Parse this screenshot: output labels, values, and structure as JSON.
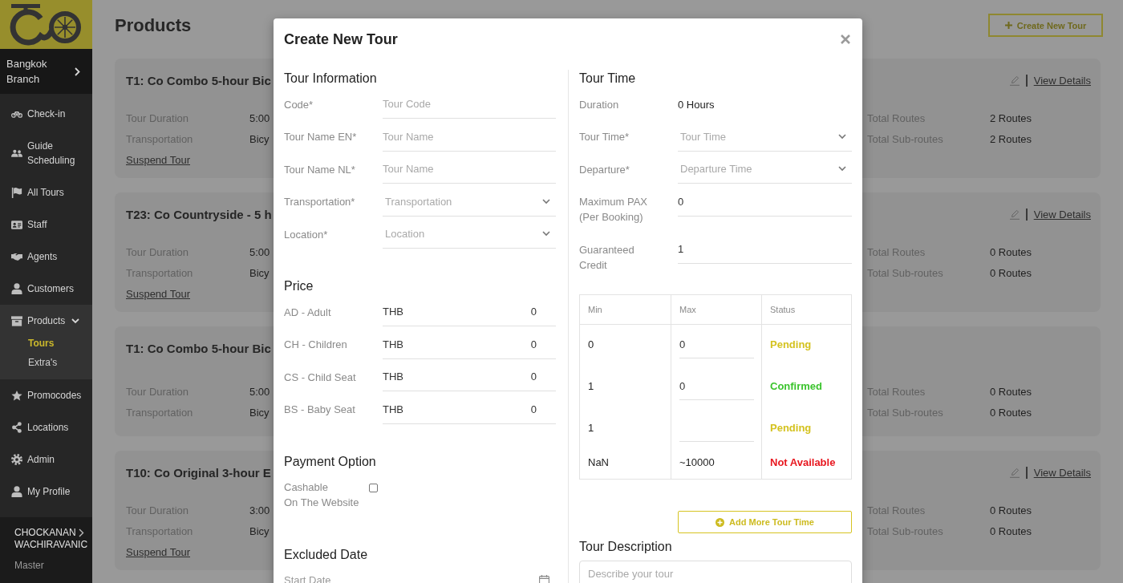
{
  "sidebar": {
    "branch": "Bangkok Branch",
    "items": [
      {
        "label": "Check-in",
        "selected": false
      },
      {
        "label": "Guide Scheduling",
        "selected": false
      },
      {
        "label": "All Tours",
        "selected": false
      },
      {
        "label": "Staff",
        "selected": false
      },
      {
        "label": "Agents",
        "selected": false
      },
      {
        "label": "Customers",
        "selected": false
      },
      {
        "label": "Products",
        "selected": true,
        "expanded": true,
        "children": [
          {
            "label": "Tours",
            "selected": true
          },
          {
            "label": "Extra's",
            "selected": false
          }
        ]
      },
      {
        "label": "Promocodes",
        "selected": false
      },
      {
        "label": "Locations",
        "selected": false
      },
      {
        "label": "Admin",
        "selected": false
      },
      {
        "label": "My Profile",
        "selected": false
      }
    ],
    "user": {
      "name_lines": [
        "CHOCKANAN",
        "WACHIRAVANIC"
      ],
      "role": "Master"
    }
  },
  "page": {
    "title": "Products",
    "create_button": "Create New Tour",
    "cards": [
      {
        "title": "T1: Co Combo 5-hour Bic",
        "link": "View Details",
        "rows": [
          [
            {
              "label": "Tour Duration",
              "value": "5:00"
            },
            {
              "label": "Total Routes",
              "value": "2 Routes"
            }
          ],
          [
            {
              "label": "Transportation",
              "value": "Bicy"
            },
            {
              "label": "Total Sub-routes",
              "value": "2 Routes"
            }
          ]
        ],
        "suspend": "Suspend Tour"
      },
      {
        "title": "T23: Co Countryside - 5 h",
        "link": "View Details",
        "rows": [
          [
            {
              "label": "Tour Duration",
              "value": "5:00"
            },
            {
              "label": "Total Routes",
              "value": "0 Routes"
            }
          ],
          [
            {
              "label": "Transportation",
              "value": "Bicy"
            },
            {
              "label": "Total Sub-routes",
              "value": "0 Routes"
            }
          ]
        ],
        "suspend": "Suspend Tour"
      },
      {
        "title": "T1: Co Combo 5-hour Bic",
        "rows": [
          [
            {
              "label": "Tour Duration",
              "value": "5:00"
            },
            {
              "label": "Total Routes",
              "value": "0 Routes"
            }
          ],
          [
            {
              "label": "Transportation",
              "value": "Bicy"
            },
            {
              "label": "Total Sub-routes",
              "value": "0 Routes"
            }
          ]
        ]
      },
      {
        "title": "T10: Co Original 3-hour E",
        "link": "View Details",
        "rows": [
          [
            {
              "label": "Tour Duration",
              "value": "3:00"
            },
            {
              "label": "Total Routes",
              "value": "0 Routes"
            }
          ],
          [
            {
              "label": "Transportation",
              "value": "Bicy"
            },
            {
              "label": "Total Sub-routes",
              "value": "0 Routes"
            }
          ]
        ],
        "suspend": "Suspend Tour"
      }
    ]
  },
  "modal": {
    "title": "Create New Tour",
    "left": [
      {
        "heading": "Tour Information",
        "fields": [
          {
            "label": "Code*",
            "kind": "input",
            "placeholder": "Tour Code"
          },
          {
            "label": "Tour Name EN*",
            "kind": "input",
            "placeholder": "Tour Name"
          },
          {
            "label": "Tour Name NL*",
            "kind": "input",
            "placeholder": "Tour Name"
          },
          {
            "label": "Transportation*",
            "kind": "select",
            "placeholder": "Transportation"
          },
          {
            "label": "Location*",
            "kind": "select",
            "placeholder": "Location"
          }
        ]
      },
      {
        "heading": "Price",
        "fields": [
          {
            "label": "AD - Adult",
            "kind": "price",
            "currency": "THB",
            "value": "0"
          },
          {
            "label": "CH - Children",
            "kind": "price",
            "currency": "THB",
            "value": "0"
          },
          {
            "label": "CS - Child Seat",
            "kind": "price",
            "currency": "THB",
            "value": "0"
          },
          {
            "label": "BS - Baby Seat",
            "kind": "price",
            "currency": "THB",
            "value": "0"
          }
        ]
      },
      {
        "heading": "Payment Option",
        "fields": [
          {
            "label": "Cashable\nOn The Website",
            "kind": "checkbox",
            "checked": false
          }
        ]
      },
      {
        "heading": "Excluded Date",
        "fields": [
          {
            "kind": "date",
            "placeholder": "Start Date"
          }
        ]
      }
    ],
    "right": [
      {
        "heading": "Tour Time",
        "fields": [
          {
            "label": "Duration",
            "kind": "text",
            "value": "0 Hours"
          },
          {
            "label": "Tour Time*",
            "kind": "select",
            "placeholder": "Tour Time"
          },
          {
            "label": "Departure*",
            "kind": "select",
            "placeholder": "Departure Time"
          },
          {
            "label": "Maximum PAX (Per Booking)",
            "kind": "input",
            "value": "0"
          },
          {
            "label": "Guaranteed Credit",
            "kind": "input",
            "value": "1"
          }
        ],
        "table": {
          "columns": [
            "Min",
            "Max",
            "Status"
          ],
          "rows": [
            {
              "min": "0",
              "max": {
                "kind": "input",
                "value": "0"
              },
              "status": "Pending",
              "color": "#d4c21f"
            },
            {
              "min": "1",
              "max": {
                "kind": "input",
                "value": "0"
              },
              "status": "Confirmed",
              "color": "#3cc42e"
            },
            {
              "min": "1",
              "max": {
                "kind": "input"
              },
              "status": "Pending",
              "color": "#d4c21f"
            },
            {
              "min": "NaN",
              "max": {
                "kind": "text",
                "value": "~10000"
              },
              "status": "Not Available",
              "color": "#e8171f"
            }
          ]
        },
        "button": "Add More Tour Time"
      },
      {
        "heading": "Tour Description",
        "fields": [
          {
            "kind": "textarea",
            "placeholder": "Describe your tour"
          }
        ]
      }
    ]
  }
}
